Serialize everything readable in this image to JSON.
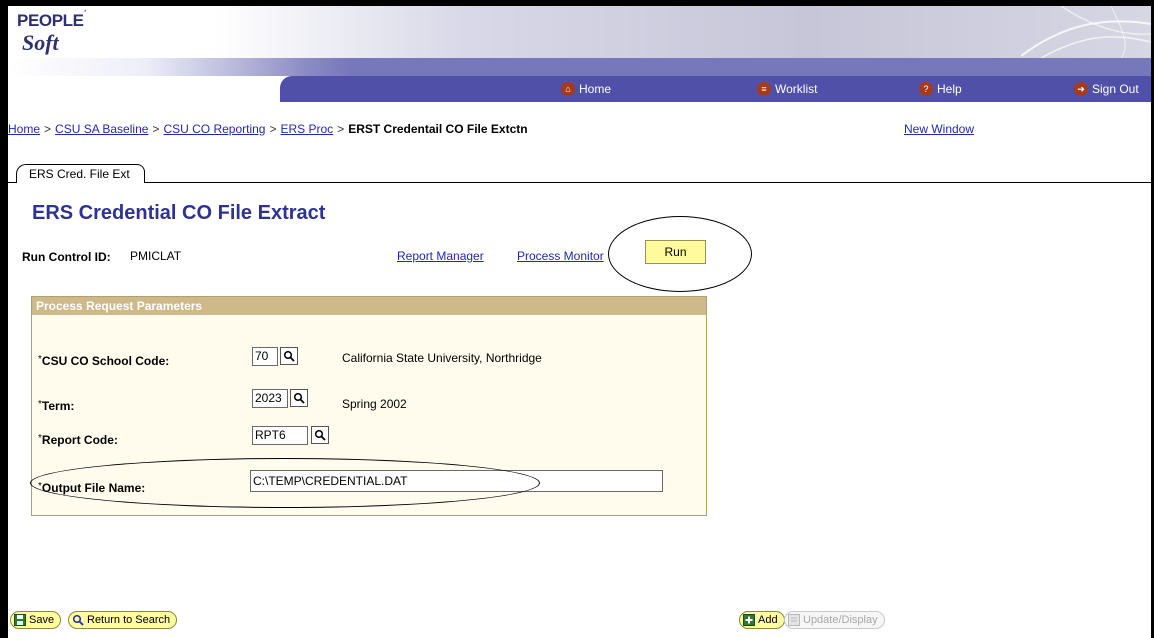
{
  "logo": {
    "line1": "PEOPLE",
    "line2": "Soft"
  },
  "nav": {
    "home": "Home",
    "worklist": "Worklist",
    "help": "Help",
    "signout": "Sign Out"
  },
  "breadcrumb": {
    "items": [
      "Home",
      "CSU SA Baseline",
      "CSU CO Reporting",
      "ERS Proc"
    ],
    "separator": ">",
    "current": "ERST Credentail CO File Extctn"
  },
  "new_window": "New Window",
  "tab": {
    "label": "ERS Cred. File Ext"
  },
  "page_title": "ERS Credential CO File Extract",
  "run_control": {
    "label": "Run Control ID:",
    "value": "PMICLAT"
  },
  "links": {
    "report_manager": "Report Manager",
    "process_monitor": "Process Monitor"
  },
  "run_button": "Run",
  "group": {
    "title": "Process Request Parameters",
    "fields": [
      {
        "req": "*",
        "label": "CSU CO School Code:",
        "value": "70",
        "description": "California State University, Northridge"
      },
      {
        "req": "*",
        "label": "Term:",
        "value": "2023",
        "description": "Spring 2002"
      },
      {
        "req": "*",
        "label": "Report Code:",
        "value": "RPT6",
        "description": ""
      },
      {
        "req": "*",
        "label": "Output File Name:",
        "value": "C:\\TEMP\\CREDENTIAL.DAT",
        "description": ""
      }
    ]
  },
  "buttons": {
    "save": "Save",
    "return_to_search": "Return to Search",
    "add": "Add",
    "update_display": "Update/Display"
  },
  "colors": {
    "link": "#1f2ab0",
    "title": "#2e3294",
    "run_button_bg": "#fffa9c",
    "group_header": "#cdb98a",
    "nav_bar": "#5050a8"
  }
}
